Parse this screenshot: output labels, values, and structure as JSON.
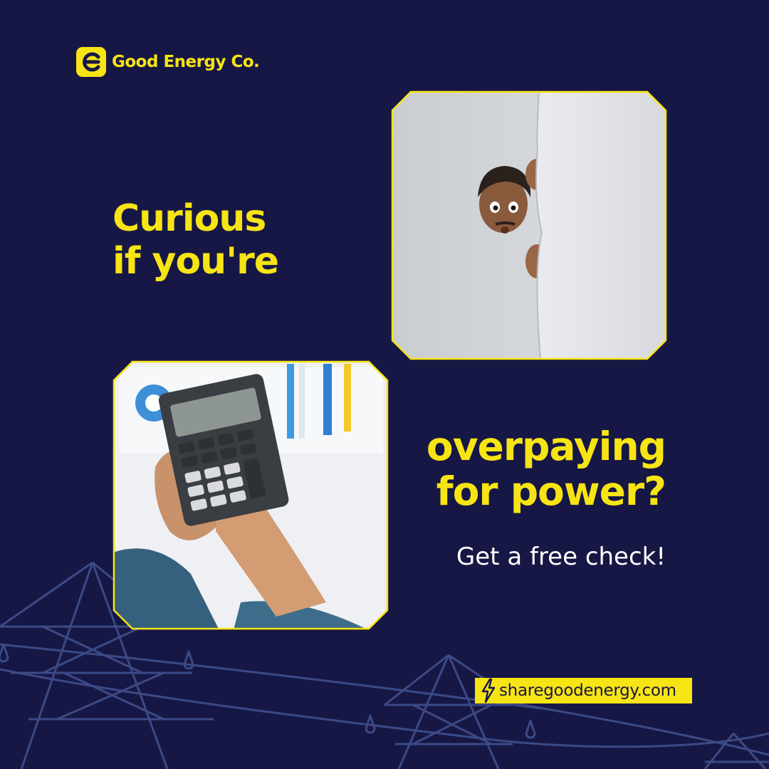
{
  "brand": {
    "name": "Good Energy Co.",
    "logo_icon": "brand-e-icon"
  },
  "headline_top": {
    "line1": "Curious",
    "line2": "if you're"
  },
  "headline_bottom": {
    "line1": "overpaying",
    "line2": "for power?"
  },
  "subheadline": "Get a free check!",
  "website": {
    "icon": "lightning-bolt-icon",
    "url": "sharegoodenergy.com"
  },
  "images": {
    "top": "photo-man-peeking-behind-wall",
    "bottom": "photo-hands-using-calculator"
  },
  "colors": {
    "background": "#171745",
    "accent": "#f7e414",
    "text_light": "#ffffff"
  }
}
